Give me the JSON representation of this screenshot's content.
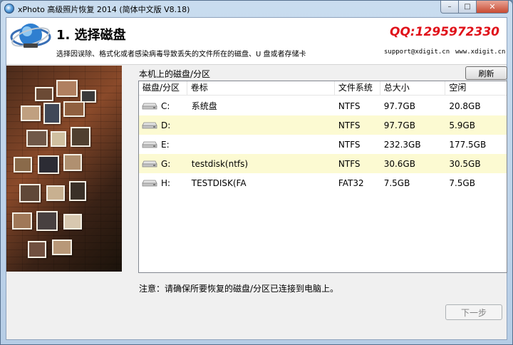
{
  "window": {
    "title": "xPhoto 高级照片恢复 2014 (简体中文版 V8.18)",
    "minimize_label": "–",
    "maximize_label": "□",
    "close_label": "✕"
  },
  "header": {
    "step_title": "1. 选择磁盘",
    "qq": "QQ:1295972330",
    "description": "选择因误除、格式化或者感染病毒导致丢失的文件所在的磁盘、U 盘或者存储卡",
    "email": "support@xdigit.cn",
    "website": "www.xdigit.cn"
  },
  "disk_section": {
    "label": "本机上的磁盘/分区",
    "refresh_label": "刷新",
    "columns": [
      "磁盘/分区",
      "卷标",
      "文件系统",
      "总大小",
      "空闲"
    ],
    "rows": [
      {
        "disk": "C:",
        "label": "系统盘",
        "fs": "NTFS",
        "size": "97.7GB",
        "free": "20.8GB"
      },
      {
        "disk": "D:",
        "label": "",
        "fs": "NTFS",
        "size": "97.7GB",
        "free": "5.9GB"
      },
      {
        "disk": "E:",
        "label": "",
        "fs": "NTFS",
        "size": "232.3GB",
        "free": "177.5GB"
      },
      {
        "disk": "G:",
        "label": "testdisk(ntfs)",
        "fs": "NTFS",
        "size": "30.6GB",
        "free": "30.5GB"
      },
      {
        "disk": "H:",
        "label": "TESTDISK(FA",
        "fs": "FAT32",
        "size": "7.5GB",
        "free": "7.5GB"
      }
    ]
  },
  "footer": {
    "notice": "注意：请确保所要恢复的磁盘/分区已连接到电脑上。",
    "next_label": "下一步"
  },
  "icons": {
    "app": "xphoto-app-icon",
    "logo": "xphoto-globe-logo",
    "drive": "hard-drive-icon"
  },
  "colors": {
    "qq_red": "#e0131b",
    "alt_row": "#fcfad2"
  }
}
